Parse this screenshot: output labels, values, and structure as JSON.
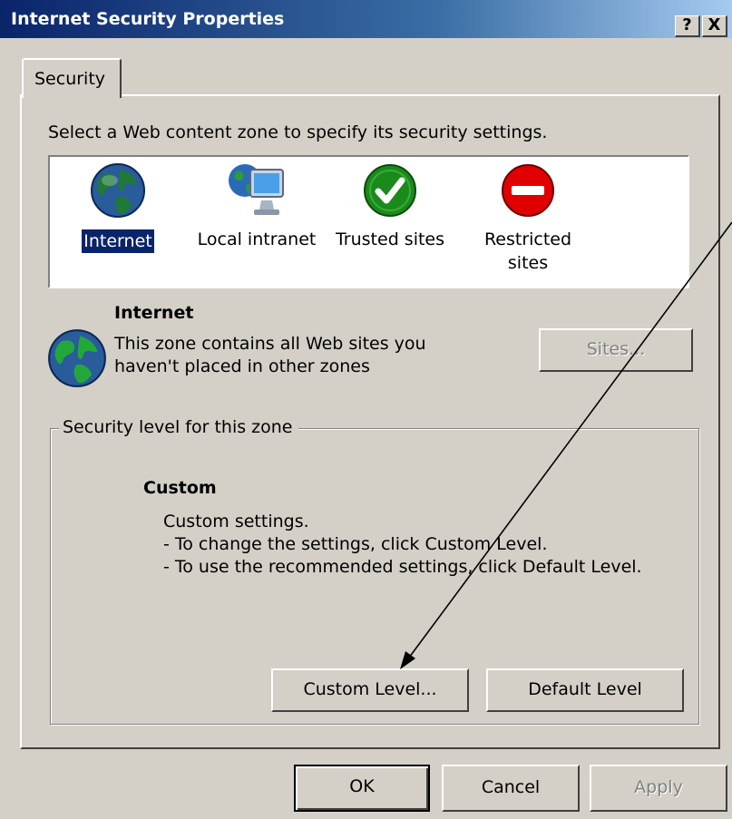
{
  "window": {
    "title": "Internet Security Properties",
    "help_glyph": "?",
    "close_glyph": "X"
  },
  "tabs": [
    {
      "label": "Security"
    }
  ],
  "instruction": "Select a Web content zone to specify its security settings.",
  "zones": [
    {
      "label": "Internet",
      "icon": "globe-icon"
    },
    {
      "label": "Local intranet",
      "icon": "intranet-computer-icon"
    },
    {
      "label": "Trusted sites",
      "icon": "checkmark-icon"
    },
    {
      "label_line1": "Restricted",
      "label_line2": "sites",
      "icon": "no-entry-icon"
    }
  ],
  "selected_zone": {
    "title": "Internet",
    "desc_line1": "This zone contains all Web sites you",
    "desc_line2": "haven't placed in other zones",
    "sites_button": "Sites..."
  },
  "security_level": {
    "group_label": "Security level for this zone",
    "level_name": "Custom",
    "line1": "Custom settings.",
    "line2": "- To change the settings, click Custom Level.",
    "line3": "- To use the recommended settings, click Default Level.",
    "custom_level_button": "Custom Level...",
    "default_level_button": "Default Level"
  },
  "footer": {
    "ok_button": "OK",
    "cancel_button": "Cancel",
    "apply_button": "Apply"
  },
  "colors": {
    "title_bar": "#0a246a",
    "dialog_face": "#d4d0c8",
    "selection": "#0a246a",
    "trusted_green": "#1a8a1a",
    "restricted_red": "#e00000"
  }
}
